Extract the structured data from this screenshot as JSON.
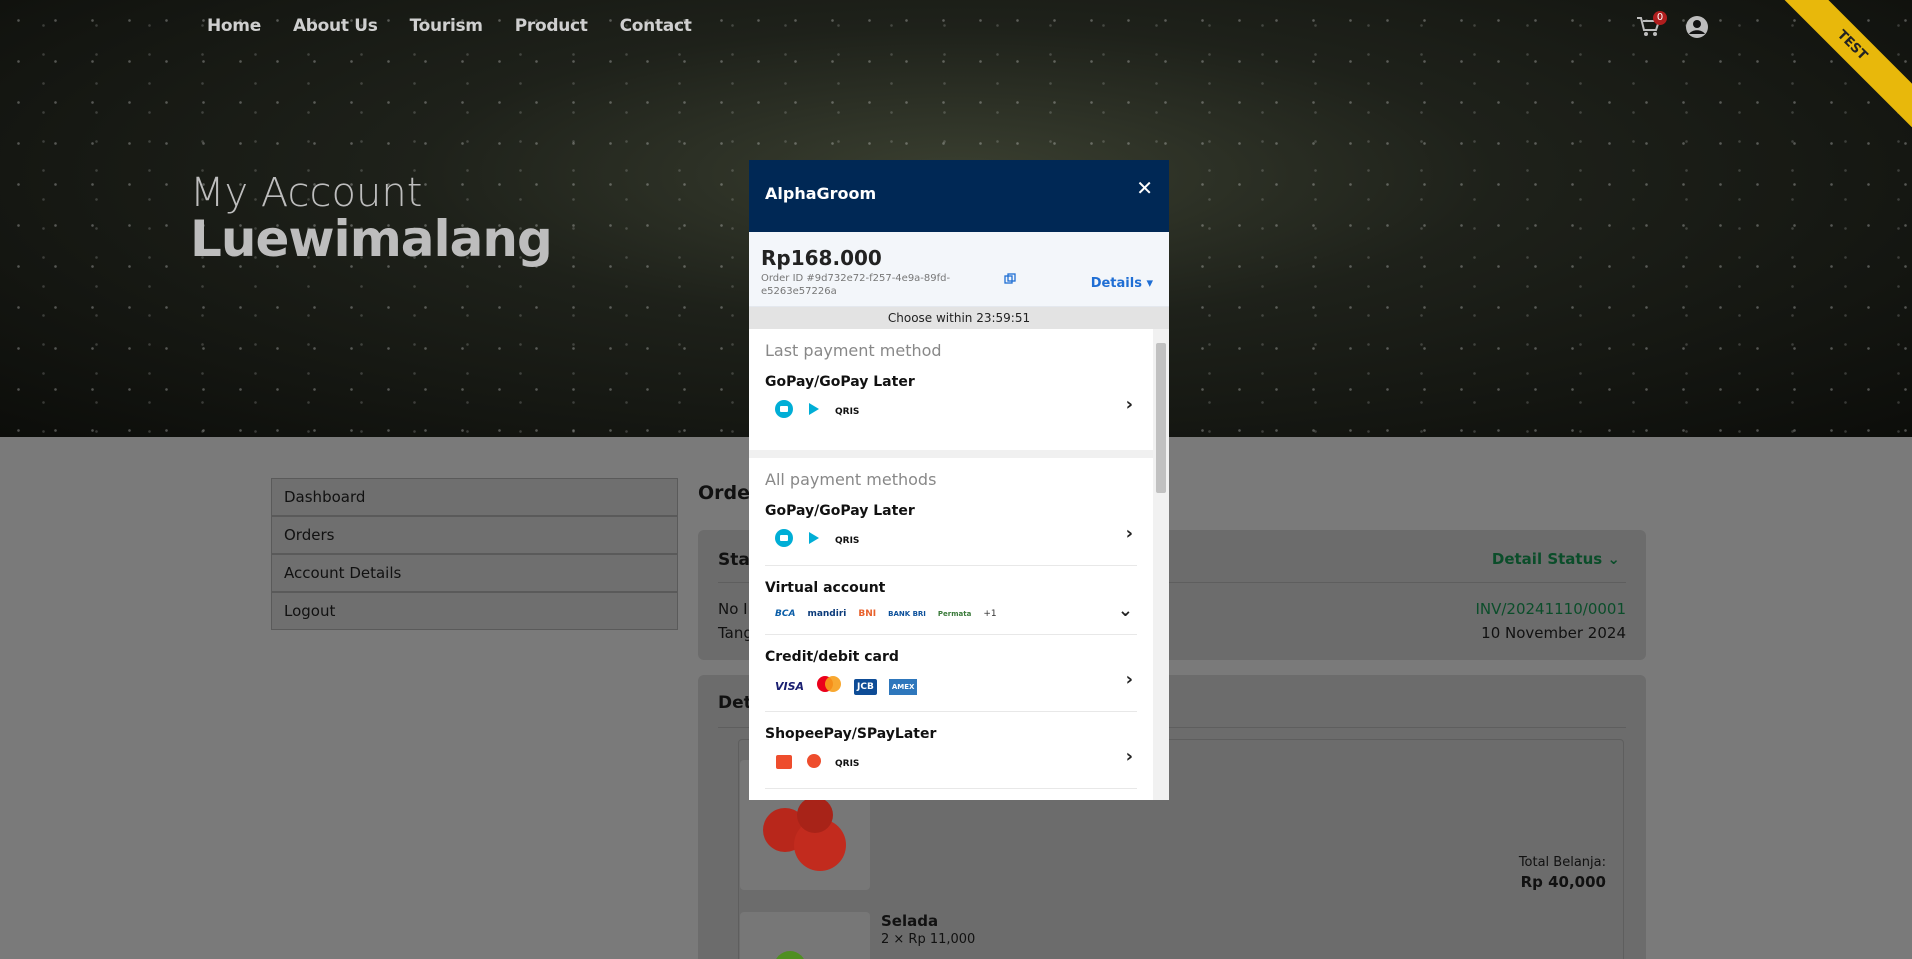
{
  "nav": [
    "Home",
    "About Us",
    "Tourism",
    "Product",
    "Contact"
  ],
  "cart_count": "0",
  "ribbon": "TEST",
  "hero": {
    "subtitle": "My Account",
    "title": "Luewimalang"
  },
  "sidebar": [
    "Dashboard",
    "Orders",
    "Account Details",
    "Logout"
  ],
  "orders_title": "Orders",
  "status": {
    "label": "Stat",
    "detail": "Detail Status",
    "invoice_label": "No In",
    "date_label": "Tang",
    "invoice": "INV/20241110/0001",
    "date": "10 November 2024"
  },
  "detail_label": "Deta",
  "items": [
    {
      "name": "Selada",
      "qty": "2 × Rp 11,000"
    }
  ],
  "total_label": "Total Belanja:",
  "total_value": "Rp 40,000",
  "modal": {
    "title": "AlphaGroom",
    "amount": "Rp168.000",
    "order_id": "Order ID #9d732e72-f257-4e9a-89fd-e5263e57226a",
    "details": "Details",
    "timer": "Choose within  23:59:51",
    "last_header": "Last payment method",
    "all_header": "All payment methods",
    "last": [
      {
        "name": "GoPay/GoPay Later",
        "icons": [
          "gopay-icon",
          "gopaylater-icon",
          "qris-icon"
        ]
      }
    ],
    "methods": [
      {
        "name": "GoPay/GoPay Later",
        "icons": [
          "gopay-icon",
          "gopaylater-icon",
          "qris-icon"
        ],
        "chevron": "›"
      },
      {
        "name": "Virtual account",
        "icons": [
          "BCA",
          "mandiri",
          "BNI",
          "BANK BRI",
          "Permata",
          "+1"
        ],
        "chevron": "⌄"
      },
      {
        "name": "Credit/debit card",
        "icons": [
          "VISA",
          "mastercard",
          "JCB",
          "AMEX"
        ],
        "chevron": "›"
      },
      {
        "name": "ShopeePay/SPayLater",
        "icons": [
          "shopeepay-icon",
          "spaylater-icon",
          "qris-icon"
        ],
        "chevron": "›"
      }
    ]
  }
}
